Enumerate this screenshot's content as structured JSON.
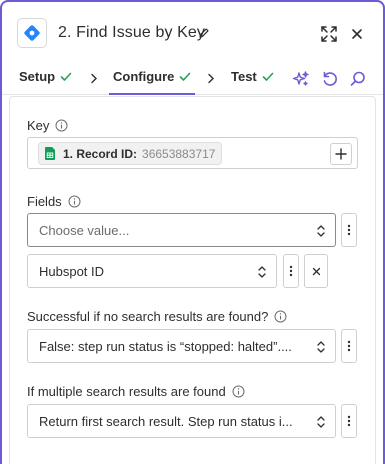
{
  "header": {
    "app_icon": "jira-diamond-icon",
    "title": "2. Find Issue by Key",
    "edit_icon": "pencil-icon",
    "expand_icon": "expand-icon",
    "close_icon": "close-icon"
  },
  "tabs": [
    {
      "label": "Setup",
      "complete": true
    },
    {
      "label": "Configure",
      "complete": true,
      "active": true
    },
    {
      "label": "Test",
      "complete": true
    }
  ],
  "toolbar": {
    "sparkle_icon": "ai-sparkle-icon",
    "refresh_icon": "refresh-icon",
    "search_icon": "search-icon"
  },
  "form": {
    "key": {
      "label": "Key",
      "pill_label": "1. Record ID:",
      "pill_value": "36653883717"
    },
    "fields": {
      "label": "Fields",
      "choose_placeholder": "Choose value...",
      "selected_value": "Hubspot ID"
    },
    "no_results": {
      "label": "Successful if no search results are found?",
      "value": "False: step run status is “stopped: halted”...."
    },
    "multiple_results": {
      "label": "If multiple search results are found",
      "value": "Return first search result. Step run status i..."
    }
  },
  "colors": {
    "accent": "#6b5bd6",
    "success": "#2e9e5b",
    "jira_blue": "#2684ff",
    "sheets_green": "#0f9d58"
  }
}
